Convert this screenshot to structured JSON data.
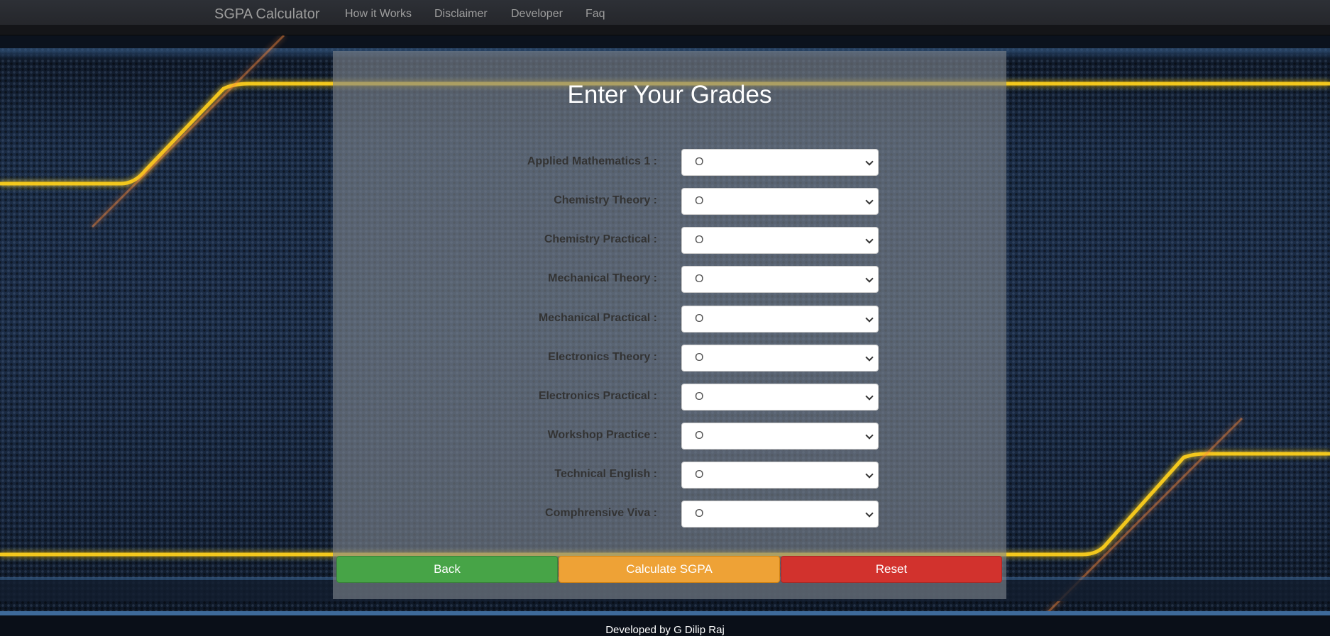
{
  "navbar": {
    "brand": "SGPA Calculator",
    "links": [
      "How it Works",
      "Disclaimer",
      "Developer",
      "Faq"
    ]
  },
  "form": {
    "title": "Enter Your Grades",
    "rows": [
      {
        "label": "Applied Mathematics 1 :",
        "value": "O"
      },
      {
        "label": "Chemistry Theory :",
        "value": "O"
      },
      {
        "label": "Chemistry Practical :",
        "value": "O"
      },
      {
        "label": "Mechanical Theory :",
        "value": "O"
      },
      {
        "label": "Mechanical Practical :",
        "value": "O"
      },
      {
        "label": "Electronics Theory :",
        "value": "O"
      },
      {
        "label": "Electronics Practical :",
        "value": "O"
      },
      {
        "label": "Workshop Practice :",
        "value": "O"
      },
      {
        "label": "Technical English :",
        "value": "O"
      },
      {
        "label": "Comphrensive Viva :",
        "value": "O"
      }
    ],
    "buttons": {
      "back": "Back",
      "calculate": "Calculate SGPA",
      "reset": "Reset"
    }
  },
  "footer": {
    "text": "Developed by G Dilip Raj"
  },
  "colors": {
    "navbar": "#2d3036",
    "accent_gold": "#f5d31a",
    "back": "#47a447",
    "calculate": "#eea236",
    "reset": "#d2322d"
  }
}
